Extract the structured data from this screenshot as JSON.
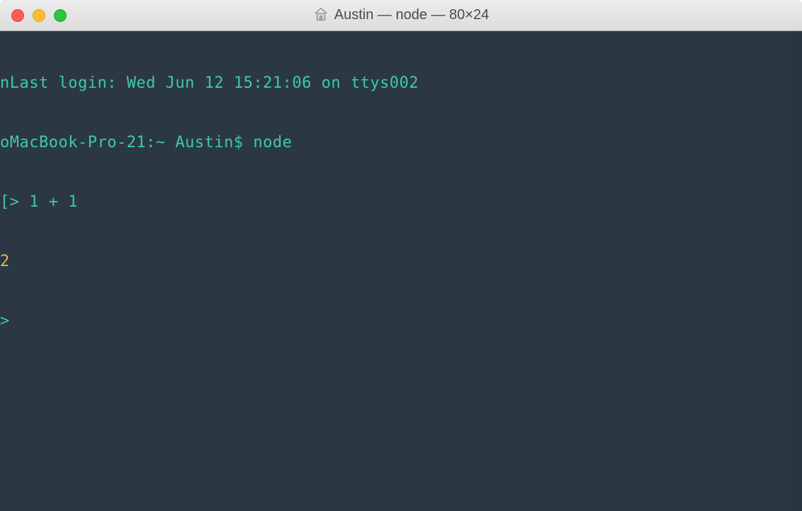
{
  "window": {
    "title": "Austin — node — 80×24"
  },
  "terminal": {
    "line1_prefix": "n",
    "line1_text": "Last login: Wed Jun 12 15:21:06 on ttys002",
    "line2_prefix": "o",
    "line2_host": "MacBook-Pro-21:~ Austin$ ",
    "line2_cmd": "node",
    "line3_prefix": "[",
    "line3_prompt": "> ",
    "line3_expr": "1 + 1",
    "line4_result": "2",
    "line5_prompt": "> "
  },
  "colors": {
    "bg": "#2b3844",
    "green": "#3ec9a7",
    "yellow": "#e6b450"
  }
}
